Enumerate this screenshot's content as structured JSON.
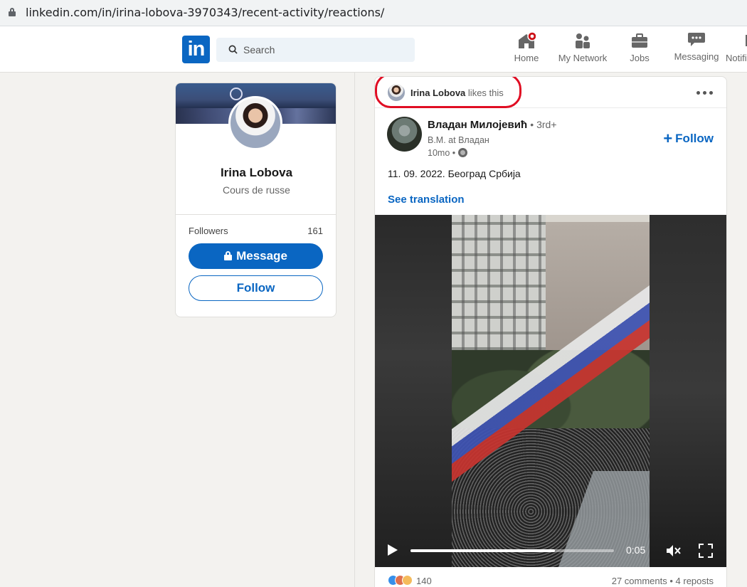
{
  "browser": {
    "url": "linkedin.com/in/irina-lobova-3970343/recent-activity/reactions/"
  },
  "nav": {
    "logo": "in",
    "search_placeholder": "Search",
    "items": [
      {
        "label": "Home",
        "icon": "home-icon",
        "badge": true
      },
      {
        "label": "My Network",
        "icon": "people-icon"
      },
      {
        "label": "Jobs",
        "icon": "briefcase-icon"
      },
      {
        "label": "Messaging",
        "icon": "chat-icon"
      },
      {
        "label": "Notifi",
        "icon": "bell-icon"
      }
    ]
  },
  "profile": {
    "name": "Irina Lobova",
    "headline": "Cours de russe",
    "followers_label": "Followers",
    "followers_count": "161",
    "message_label": "Message",
    "follow_label": "Follow"
  },
  "post": {
    "liked_by": "Irina Lobova",
    "liked_suffix": "likes this",
    "author_name": "Владан Милојевић",
    "author_degree": "• 3rd+",
    "author_title": "B.M. at Владан",
    "author_time": "10mo •",
    "follow_label": "Follow",
    "text": "11. 09. 2022. Београд Србија",
    "see_translation": "See translation",
    "video": {
      "time": "0:05",
      "progress": 0.71
    },
    "reactions_count": "140",
    "stats": "27 comments • 4 reposts",
    "colors": {
      "accent": "#0a66c2",
      "highlight": "#e00d23"
    }
  }
}
